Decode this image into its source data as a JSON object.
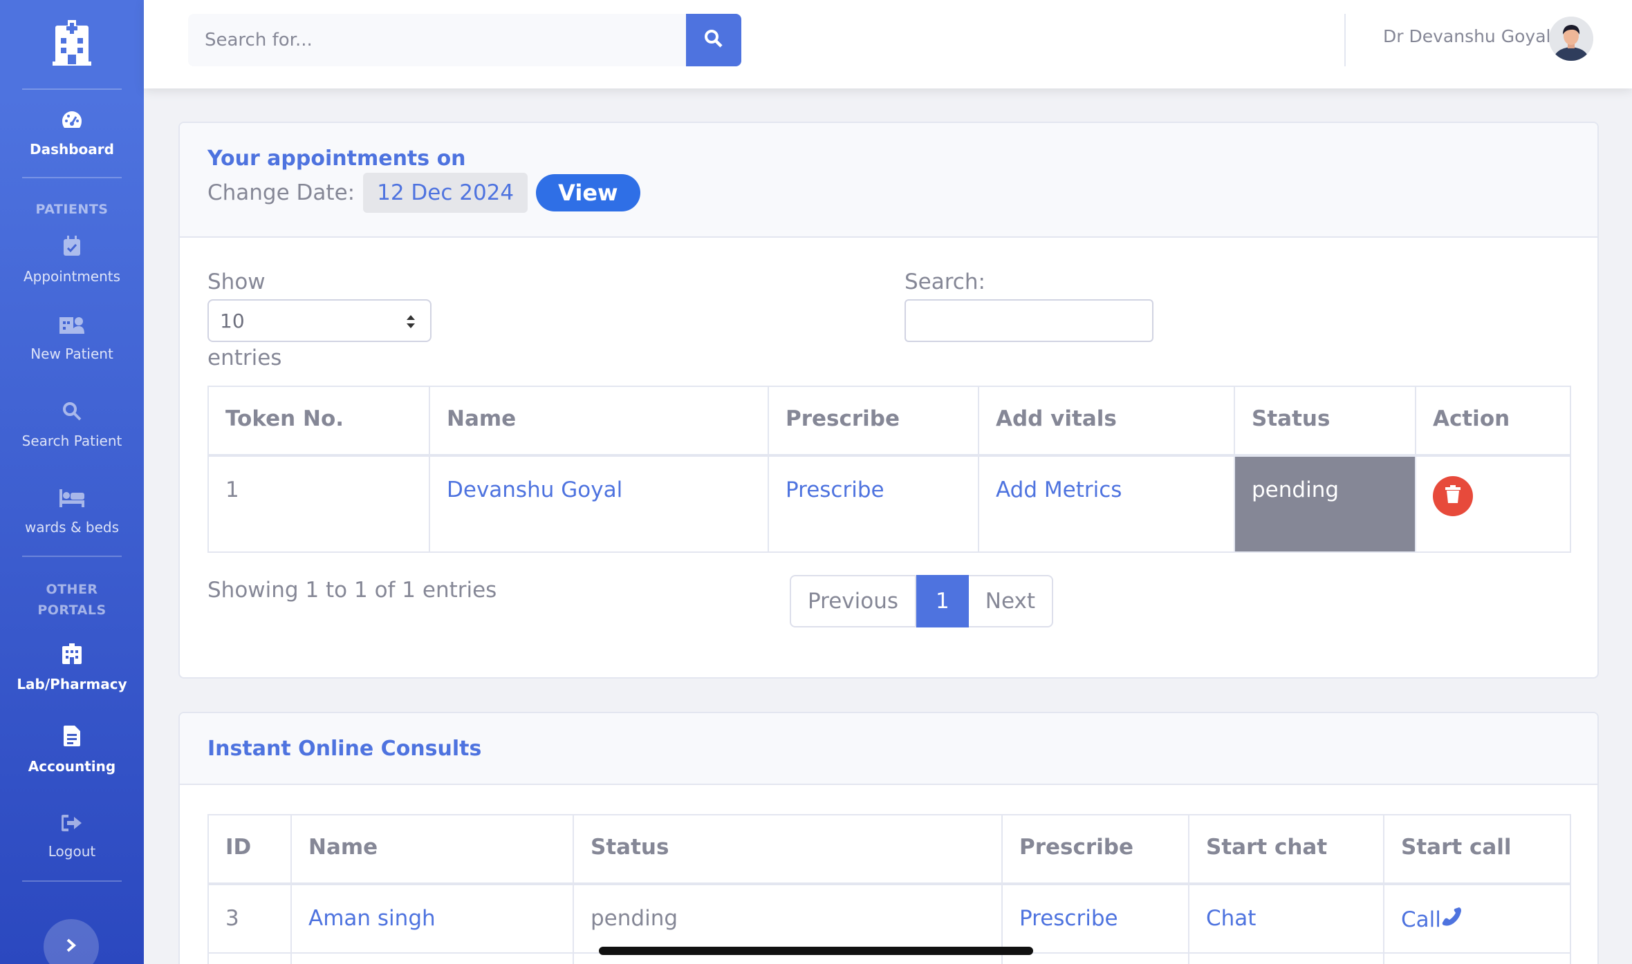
{
  "sidebar": {
    "brand_icon": "hospital-icon",
    "items": [
      {
        "label": "Dashboard",
        "icon": "tachometer-icon"
      },
      {
        "label": "Appointments",
        "icon": "calendar-check-icon"
      },
      {
        "label": "New Patient",
        "icon": "hospital-user-icon"
      },
      {
        "label": "Search Patient",
        "icon": "search-icon"
      },
      {
        "label": "wards & beds",
        "icon": "bed-icon"
      },
      {
        "label": "Lab/Pharmacy",
        "icon": "clinic-icon"
      },
      {
        "label": "Accounting",
        "icon": "file-invoice-icon"
      },
      {
        "label": "Logout",
        "icon": "sign-out-icon"
      }
    ],
    "headings": {
      "patients": "PATIENTS",
      "other": "OTHER PORTALS"
    }
  },
  "topbar": {
    "search_placeholder": "Search for...",
    "user_name": "Dr Devanshu Goyal"
  },
  "appointments": {
    "title": "Your appointments on",
    "change_date_label": "Change Date:",
    "date": "12 Dec 2024",
    "view_label": "View",
    "show_label": "Show",
    "entries_label": "entries",
    "page_size": "10",
    "search_label": "Search:",
    "columns": [
      "Token No.",
      "Name",
      "Prescribe",
      "Add vitals",
      "Status",
      "Action"
    ],
    "rows": [
      {
        "token": "1",
        "name": "Devanshu Goyal",
        "prescribe": "Prescribe",
        "vitals": "Add Metrics",
        "status": "pending"
      }
    ],
    "info": "Showing 1 to 1 of 1 entries",
    "pager": {
      "prev": "Previous",
      "current": "1",
      "next": "Next"
    }
  },
  "consults": {
    "title": "Instant Online Consults",
    "columns": [
      "ID",
      "Name",
      "Status",
      "Prescribe",
      "Start chat",
      "Start call"
    ],
    "rows": [
      {
        "id": "3",
        "name": "Aman singh",
        "status": "pending",
        "prescribe": "Prescribe",
        "chat": "Chat",
        "call": "Call"
      }
    ]
  },
  "colors": {
    "primary": "#4e73df",
    "danger": "#e74a3b",
    "secondary": "#858796",
    "view_button": "#2f6fe6"
  }
}
